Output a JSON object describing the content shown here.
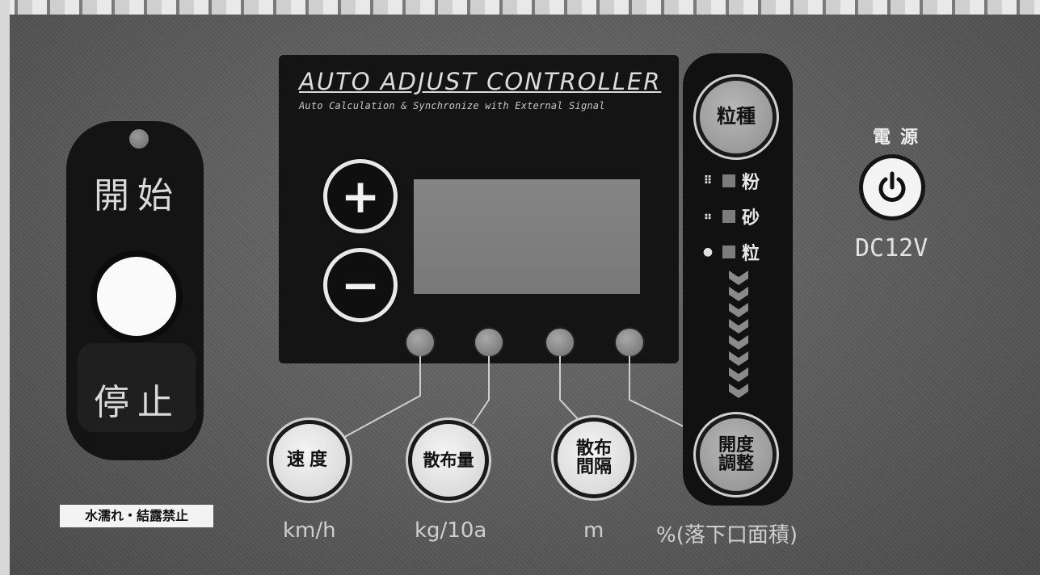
{
  "start_stop": {
    "start_label": "開始",
    "stop_label": "停止",
    "warning": "水濡れ・結露禁止"
  },
  "display": {
    "title": "AUTO ADJUST CONTROLLER",
    "subtitle": "Auto Calculation & Synchronize with External Signal",
    "plus_label": "+",
    "minus_label": "−"
  },
  "functions": [
    {
      "label": "速度",
      "unit": "km/h"
    },
    {
      "label": "散布量",
      "unit": "kg/10a"
    },
    {
      "label": "散布\n間隔",
      "unit": "m"
    },
    {
      "label": "開度\n調整",
      "unit": "%(落下口面積)"
    }
  ],
  "grain": {
    "button_label": "粒種",
    "types": [
      {
        "symbol": "⠿",
        "label": "粉"
      },
      {
        "symbol": "⠶",
        "label": "砂"
      },
      {
        "symbol": "●",
        "label": "粒"
      }
    ]
  },
  "power": {
    "title": "電源",
    "voltage": "DC12V"
  }
}
